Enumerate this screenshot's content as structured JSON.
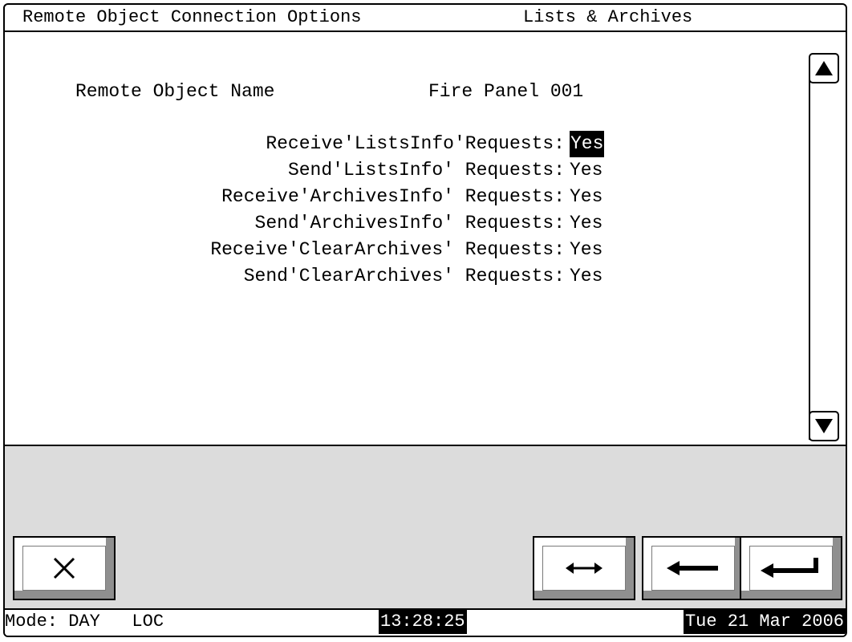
{
  "title_bar": {
    "left": "Remote Object Connection Options",
    "right": "Lists & Archives"
  },
  "object": {
    "name_label": "Remote Object Name",
    "name_value": "Fire Panel 001"
  },
  "options": [
    {
      "label": "Receive'ListsInfo'Requests:",
      "value": "Yes",
      "selected": true
    },
    {
      "label": "Send'ListsInfo' Requests:",
      "value": "Yes",
      "selected": false
    },
    {
      "label": "Receive'ArchivesInfo' Requests:",
      "value": "Yes",
      "selected": false
    },
    {
      "label": "Send'ArchivesInfo' Requests:",
      "value": "Yes",
      "selected": false
    },
    {
      "label": "Receive'ClearArchives' Requests:",
      "value": "Yes",
      "selected": false
    },
    {
      "label": "Send'ClearArchives' Requests:",
      "value": "Yes",
      "selected": false
    }
  ],
  "scroll": {
    "up_icon": "triangle-up-icon",
    "down_icon": "triangle-down-icon"
  },
  "buttons": {
    "cancel_icon": "close-x-icon",
    "toggle_icon": "double-arrow-icon",
    "back_icon": "left-arrow-icon",
    "enter_icon": "enter-arrow-icon"
  },
  "status": {
    "mode": "Mode: DAY   LOC",
    "time": "13:28:25",
    "date": "Tue 21 Mar 2006"
  }
}
